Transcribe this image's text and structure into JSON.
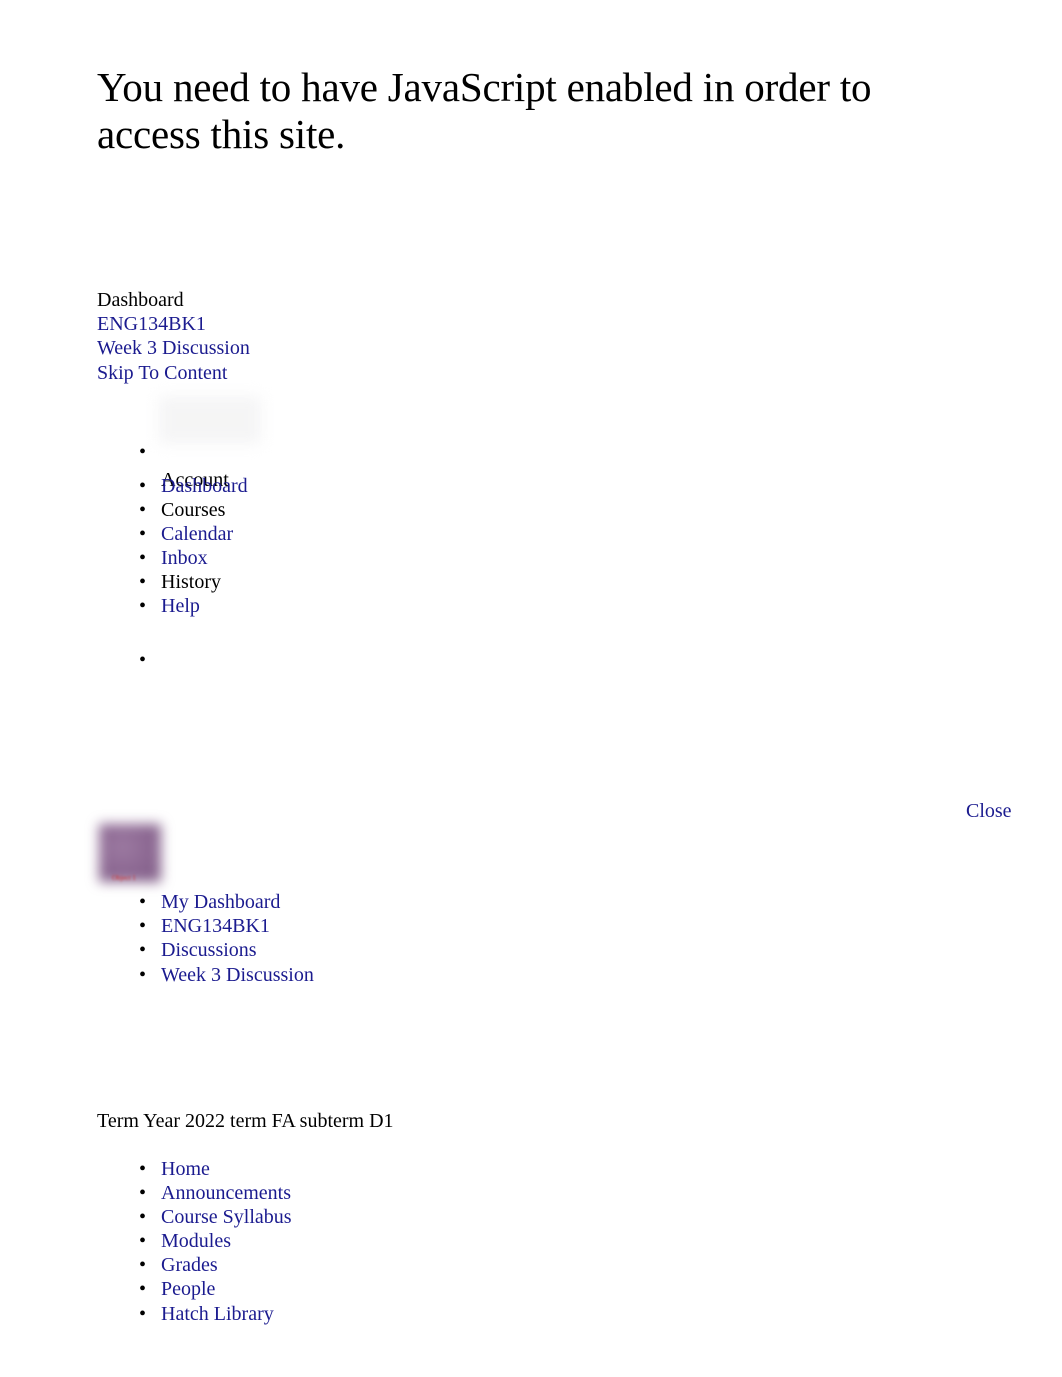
{
  "colors": {
    "link": "#1b1b8f",
    "text": "#000000",
    "background": "#ffffff",
    "course_image": "#8e6a94",
    "alt_text": "#d03030"
  },
  "notice": {
    "heading": "You need to have JavaScript enabled in order to access this site."
  },
  "top_links": {
    "dashboard": "Dashboard",
    "course_code": "ENG134BK1",
    "page_title": "Week 3 Discussion",
    "skip_to_content": "Skip To Content"
  },
  "global_nav": {
    "avatar_label": "Account",
    "items": [
      {
        "label": "Account",
        "is_link": false
      },
      {
        "label": "Dashboard",
        "is_link": true
      },
      {
        "label": "Courses",
        "is_link": false
      },
      {
        "label": "Calendar",
        "is_link": true
      },
      {
        "label": "Inbox",
        "is_link": true
      },
      {
        "label": "History",
        "is_link": false
      },
      {
        "label": "Help",
        "is_link": true
      }
    ],
    "empty_item": ""
  },
  "tray": {
    "close_label": "Close"
  },
  "course_card": {
    "image_alt": "Object 1"
  },
  "breadcrumbs": {
    "items": [
      {
        "label": "My Dashboard"
      },
      {
        "label": "ENG134BK1"
      },
      {
        "label": "Discussions"
      },
      {
        "label": "Week 3 Discussion"
      }
    ]
  },
  "term": {
    "line": "Term Year 2022 term FA subterm D1"
  },
  "course_nav": {
    "items": [
      {
        "label": "Home"
      },
      {
        "label": "Announcements"
      },
      {
        "label": "Course Syllabus"
      },
      {
        "label": "Modules"
      },
      {
        "label": "Grades"
      },
      {
        "label": "People"
      },
      {
        "label": "Hatch Library"
      }
    ]
  }
}
